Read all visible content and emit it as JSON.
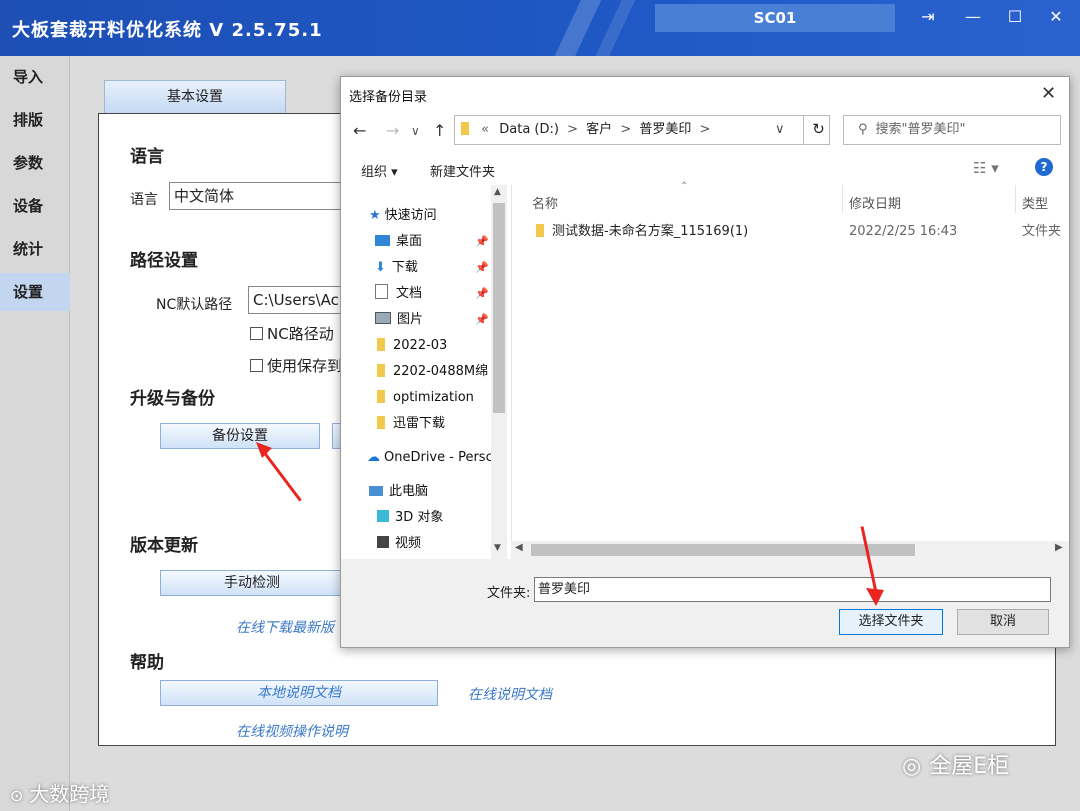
{
  "app": {
    "title": "大板套裁开料优化系统 V 2.5.75.1",
    "user_code": "SC01"
  },
  "window_controls": {
    "logout": "⇥",
    "minimize": "—",
    "maximize": "☐",
    "close": "✕"
  },
  "nav": [
    {
      "label": "导入"
    },
    {
      "label": "排版"
    },
    {
      "label": "参数"
    },
    {
      "label": "设备"
    },
    {
      "label": "统计"
    },
    {
      "label": "设置",
      "active": true
    }
  ],
  "settings": {
    "tab": "基本设置",
    "language_section": "语言",
    "language_label": "语言",
    "language_value": "中文简体",
    "path_section": "路径设置",
    "nc_path_label": "NC默认路径",
    "nc_path_value": "C:\\Users\\Ac",
    "nc_path_auto_label": "NC路径动",
    "use_saved_label": "使用保存到",
    "upgrade_section": "升级与备份",
    "backup_button": "备份设置",
    "version_section": "版本更新",
    "manual_check_button": "手动检测",
    "online_download_link": "在线下载最新版",
    "help_section": "帮助",
    "local_doc_button": "本地说明文档",
    "online_doc_link": "在线说明文档",
    "online_video_link": "在线视频操作说明"
  },
  "dialog": {
    "title": "选择备份目录",
    "close": "✕",
    "breadcrumb": [
      "«",
      "Data (D:)",
      ">",
      "客户",
      ">",
      "普罗美印",
      ">"
    ],
    "search_placeholder": "搜索\"普罗美印\"",
    "organize": "组织 ▾",
    "new_folder": "新建文件夹",
    "help": "?",
    "tree": [
      {
        "label": "快速访问",
        "icon": "star-icon"
      },
      {
        "label": "桌面",
        "icon": "desktop-icon",
        "pinned": true
      },
      {
        "label": "下载",
        "icon": "download-icon",
        "pinned": true
      },
      {
        "label": "文档",
        "icon": "document-icon",
        "pinned": true
      },
      {
        "label": "图片",
        "icon": "picture-icon",
        "pinned": true
      },
      {
        "label": "2022-03",
        "icon": "folder-icon"
      },
      {
        "label": "2202-0488M绵",
        "icon": "folder-icon"
      },
      {
        "label": "optimization",
        "icon": "folder-icon"
      },
      {
        "label": "迅雷下载",
        "icon": "folder-icon"
      },
      {
        "label": "OneDrive - Persc",
        "icon": "cloud-icon"
      },
      {
        "label": "此电脑",
        "icon": "computer-icon"
      },
      {
        "label": "3D 对象",
        "icon": "cube-icon"
      },
      {
        "label": "视频",
        "icon": "video-icon"
      }
    ],
    "columns": {
      "name": "名称",
      "modified": "修改日期",
      "type": "类型"
    },
    "files": [
      {
        "name": "测试数据-未命名方案_115169(1)",
        "modified": "2022/2/25 16:43",
        "type": "文件夹"
      }
    ],
    "folder_label": "文件夹:",
    "folder_value": "普罗美印",
    "select_button": "选择文件夹",
    "cancel_button": "取消"
  },
  "watermarks": {
    "left": "大数跨境",
    "right": "全屋E柜"
  },
  "colors": {
    "titlebar": "#1f58c4",
    "arrow": "#e8251f",
    "link": "#3a78c9"
  }
}
